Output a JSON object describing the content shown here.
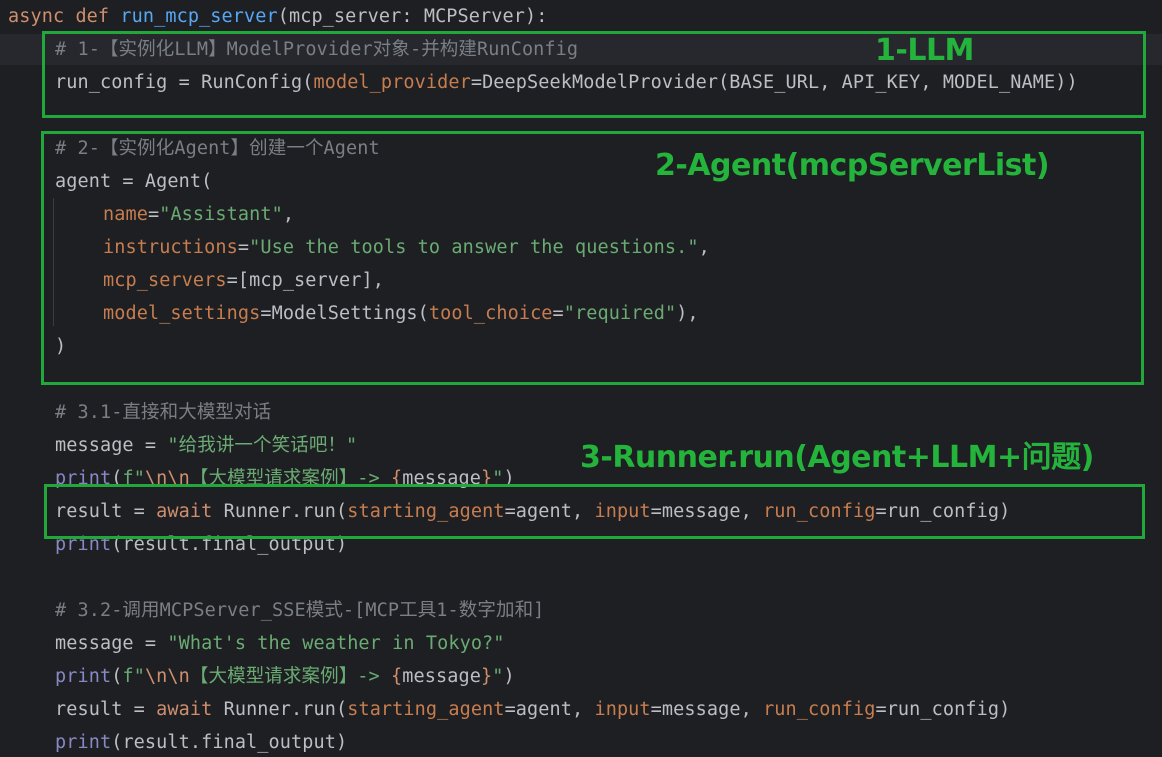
{
  "code_lines": [
    {
      "id": "l1",
      "tokens": [
        {
          "t": "async ",
          "c": "kw"
        },
        {
          "t": "def ",
          "c": "kw"
        },
        {
          "t": "run_mcp_server",
          "c": "fn"
        },
        {
          "t": "(mcp_server: MCPServer):",
          "c": "plain"
        }
      ]
    },
    {
      "id": "l2",
      "tokens": [
        {
          "t": "# 1-【实例化LLM】ModelProvider对象-并构建RunConfig",
          "c": "cmt"
        }
      ]
    },
    {
      "id": "l3",
      "tokens": [
        {
          "t": "run_config = RunConfig(",
          "c": "plain"
        },
        {
          "t": "model_provider",
          "c": "param2"
        },
        {
          "t": "=DeepSeekModelProvider(BASE_URL, API_KEY, MODEL_NAME))",
          "c": "plain"
        }
      ]
    },
    {
      "id": "l4",
      "tokens": [
        {
          "t": "# 2-【实例化Agent】创建一个Agent",
          "c": "cmt"
        }
      ]
    },
    {
      "id": "l5",
      "tokens": [
        {
          "t": "agent = Agent(",
          "c": "plain"
        }
      ]
    },
    {
      "id": "l6",
      "tokens": [
        {
          "t": "name",
          "c": "param2"
        },
        {
          "t": "=",
          "c": "plain"
        },
        {
          "t": "\"Assistant\"",
          "c": "str"
        },
        {
          "t": ",",
          "c": "plain"
        }
      ]
    },
    {
      "id": "l7",
      "tokens": [
        {
          "t": "instructions",
          "c": "param2"
        },
        {
          "t": "=",
          "c": "plain"
        },
        {
          "t": "\"Use the tools to answer the questions.\"",
          "c": "str"
        },
        {
          "t": ",",
          "c": "plain"
        }
      ]
    },
    {
      "id": "l8",
      "tokens": [
        {
          "t": "mcp_servers",
          "c": "param2"
        },
        {
          "t": "=[mcp_server],",
          "c": "plain"
        }
      ]
    },
    {
      "id": "l9",
      "tokens": [
        {
          "t": "model_settings",
          "c": "param2"
        },
        {
          "t": "=ModelSettings(",
          "c": "plain"
        },
        {
          "t": "tool_choice",
          "c": "param2"
        },
        {
          "t": "=",
          "c": "plain"
        },
        {
          "t": "\"required\"",
          "c": "str"
        },
        {
          "t": "),",
          "c": "plain"
        }
      ]
    },
    {
      "id": "l10",
      "tokens": [
        {
          "t": ")",
          "c": "plain"
        }
      ]
    },
    {
      "id": "l11",
      "tokens": [
        {
          "t": "# 3.1-直接和大模型对话",
          "c": "cmt"
        }
      ]
    },
    {
      "id": "l12",
      "tokens": [
        {
          "t": "message = ",
          "c": "plain"
        },
        {
          "t": "\"给我讲一个笑话吧！\"",
          "c": "str"
        }
      ]
    },
    {
      "id": "l13",
      "tokens": [
        {
          "t": "print",
          "c": "builtin"
        },
        {
          "t": "(",
          "c": "plain"
        },
        {
          "t": "f\"",
          "c": "str"
        },
        {
          "t": "\\n\\n",
          "c": "esc"
        },
        {
          "t": "【大模型请求案例】-> ",
          "c": "str"
        },
        {
          "t": "{",
          "c": "brace"
        },
        {
          "t": "message",
          "c": "plain"
        },
        {
          "t": "}",
          "c": "brace"
        },
        {
          "t": "\"",
          "c": "str"
        },
        {
          "t": ")",
          "c": "plain"
        }
      ]
    },
    {
      "id": "l14",
      "tokens": [
        {
          "t": "result = ",
          "c": "plain"
        },
        {
          "t": "await ",
          "c": "kw"
        },
        {
          "t": "Runner.run(",
          "c": "plain"
        },
        {
          "t": "starting_agent",
          "c": "param2"
        },
        {
          "t": "=agent, ",
          "c": "plain"
        },
        {
          "t": "input",
          "c": "param2"
        },
        {
          "t": "=message, ",
          "c": "plain"
        },
        {
          "t": "run_config",
          "c": "param2"
        },
        {
          "t": "=run_config)",
          "c": "plain"
        }
      ]
    },
    {
      "id": "l15",
      "tokens": [
        {
          "t": "print",
          "c": "builtin"
        },
        {
          "t": "(result.final_output)",
          "c": "plain"
        }
      ]
    },
    {
      "id": "l16",
      "tokens": [
        {
          "t": "# 3.2-调用MCPServer_SSE模式-[MCP工具1-数字加和]",
          "c": "cmt"
        }
      ]
    },
    {
      "id": "l17",
      "tokens": [
        {
          "t": "message = ",
          "c": "plain"
        },
        {
          "t": "\"What's the weather in Tokyo?\"",
          "c": "str"
        }
      ]
    },
    {
      "id": "l18",
      "tokens": [
        {
          "t": "print",
          "c": "builtin"
        },
        {
          "t": "(",
          "c": "plain"
        },
        {
          "t": "f\"",
          "c": "str"
        },
        {
          "t": "\\n\\n",
          "c": "esc"
        },
        {
          "t": "【大模型请求案例】-> ",
          "c": "str"
        },
        {
          "t": "{",
          "c": "brace"
        },
        {
          "t": "message",
          "c": "plain"
        },
        {
          "t": "}",
          "c": "brace"
        },
        {
          "t": "\"",
          "c": "str"
        },
        {
          "t": ")",
          "c": "plain"
        }
      ]
    },
    {
      "id": "l19",
      "tokens": [
        {
          "t": "result = ",
          "c": "plain"
        },
        {
          "t": "await ",
          "c": "kw"
        },
        {
          "t": "Runner.run(",
          "c": "plain"
        },
        {
          "t": "starting_agent",
          "c": "param2"
        },
        {
          "t": "=agent, ",
          "c": "plain"
        },
        {
          "t": "input",
          "c": "param2"
        },
        {
          "t": "=message, ",
          "c": "plain"
        },
        {
          "t": "run_config",
          "c": "param2"
        },
        {
          "t": "=run_config)",
          "c": "plain"
        }
      ]
    },
    {
      "id": "l20",
      "tokens": [
        {
          "t": "print",
          "c": "builtin"
        },
        {
          "t": "(result.final_output)",
          "c": "plain"
        }
      ]
    }
  ],
  "annotations": {
    "llm_label": "1-LLM",
    "agent_label": "2-Agent(mcpServerList)",
    "runner_label": "3-Runner.run(Agent+LLM+问题)"
  },
  "colors": {
    "background": "#1e1f22",
    "annotation_green": "#22a83a",
    "keyword": "#cf8e6d",
    "function": "#56a8f5",
    "string": "#6aab73",
    "comment": "#7a7e85",
    "parameter": "#c77d4f",
    "builtin": "#8888c6"
  }
}
